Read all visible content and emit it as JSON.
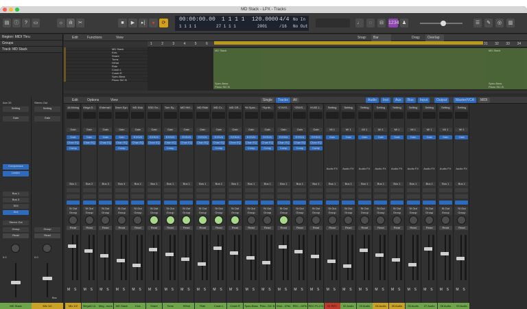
{
  "window": {
    "title": "MD Stack - LPX - Tracks"
  },
  "toolbar": {
    "lcd_time": "00:00:00.00",
    "lcd_bars": "1 1 1 1",
    "lcd_bars2": "1 1 1 1",
    "lcd_pos": "27 1 1 1",
    "tempo": "120.0000",
    "tempo_sub": "2001",
    "signature": "4/4",
    "division": "/16",
    "in_label": "No In",
    "out_label": "No Out",
    "badge": "1234"
  },
  "inspector": {
    "region": "Region: MIDI Thru",
    "groups": "Groups",
    "track": "Track: MD Stack"
  },
  "tracks_bar": {
    "edit": "Edit",
    "functions": "Functions",
    "view": "View",
    "snap_label": "Snap:",
    "snap_value": "Bar",
    "drag_label": "Drag:",
    "drag_value": "Overlap"
  },
  "ruler": [
    "1",
    "2",
    "3",
    "4",
    "5",
    "6",
    "7",
    "8",
    "9",
    "10",
    "11",
    "12",
    "13",
    "14",
    "15",
    "16",
    "17",
    "18",
    "19",
    "20",
    "21",
    "22",
    "23",
    "24",
    "25",
    "26",
    "27",
    "28",
    "29",
    "30",
    "31",
    "32",
    "33",
    "34"
  ],
  "track_rows": [
    "MD Stack",
    "Kick",
    "Snare",
    "Toms",
    "HiHat",
    "Ride",
    "Crash L",
    "Crash R",
    "Spec-Bass",
    "Piano SIC B"
  ],
  "regions": {
    "main": "MD Stack",
    "end": "MD Stack",
    "spec": "Spec-Bass",
    "piano": "Piano SIC B",
    "spec2": "Spec-Bass",
    "piano2": "Piano SIC B"
  },
  "mixer_bar": {
    "edit": "Edit",
    "options": "Options",
    "view": "View",
    "tabs_left": [
      "Single",
      "Tracks",
      "All"
    ],
    "tabs_right": [
      "Audio",
      "Inst",
      "Aux",
      "Bus",
      "Input",
      "Output",
      "Master/VCA",
      "MIDI"
    ]
  },
  "inspector_strips": {
    "left_name": "MD Stack",
    "left_eq": "Aux 33",
    "right_name": "Mix 1/2",
    "right_eq": "Stereo Out",
    "settings": "Setting",
    "left_group": "Group",
    "right_group": "Group",
    "read": "Read",
    "read2": "Read",
    "val_left": "0.0",
    "val_right": "0.0",
    "comp": "Compressor",
    "limiter": "Limiter",
    "gain": "Gain",
    "bus1": "Bus 1",
    "bus3": "Bus 3",
    "s503": "S03",
    "s504": "S04",
    "out": "Stereo Out",
    "bnc": "Bnc"
  },
  "channels": [
    {
      "name": "Mix 1/2",
      "plugin": "JA Mixing",
      "color": "#c9a227",
      "send": "Bus 1"
    },
    {
      "name": "MegaD Lit",
      "plugin": "Mega D...",
      "color": "#6fa54a",
      "send": "Bus 2"
    },
    {
      "name": "Meg...nuns",
      "plugin": "External I",
      "color": "#6fa54a",
      "send": "Bus 3"
    },
    {
      "name": "MD Stack",
      "plugin": "Drum Syn...",
      "color": "#6fa54a",
      "send": "Bus 4"
    },
    {
      "name": "Kick",
      "plugin": "MD Kick",
      "color": "#6fa54a",
      "send": "Bus 1"
    },
    {
      "name": "Snare",
      "plugin": "SSD Sn...",
      "color": "#6fa54a",
      "send": "Bus 1"
    },
    {
      "name": "Toms",
      "plugin": "Tom Sy...",
      "color": "#6fa54a",
      "send": "Bus 1"
    },
    {
      "name": "HiHat",
      "plugin": "MD HiH...",
      "color": "#6fa54a",
      "send": "Bus 1"
    },
    {
      "name": "Ride",
      "plugin": "MD Ride",
      "color": "#6fa54a",
      "send": "Bus 1"
    },
    {
      "name": "Crash L",
      "plugin": "MD Cr...",
      "color": "#6fa54a",
      "send": "Bus 1"
    },
    {
      "name": "Crash R",
      "plugin": "MD CR...",
      "color": "#6fa54a",
      "send": "Bus 1"
    },
    {
      "name": "Spec-Bass",
      "plugin": "*M Spec...",
      "color": "#6fa54a",
      "send": "Bus 1"
    },
    {
      "name": "Pian...SIC B",
      "plugin": "*Synth...",
      "color": "#6fa54a",
      "send": "Bus 1"
    },
    {
      "name": "Wurl...37bb",
      "plugin": "*Z BXS...",
      "color": "#6fa54a",
      "send": "Bus 1"
    },
    {
      "name": "REC...DiPA",
      "plugin": "*ZBXS...",
      "color": "#6fa54a",
      "send": "Bus 1"
    },
    {
      "name": "REC PL1+D",
      "plugin": "KV83 J...",
      "color": "#6fa54a",
      "send": "Bus 1"
    },
    {
      "name": "01 REC",
      "plugin": "Setting",
      "color": "#c0392b",
      "send": "Bus 1"
    },
    {
      "name": "02 Audio",
      "plugin": "Setting",
      "color": "#6fa54a",
      "send": "Bus 1"
    },
    {
      "name": "03 Audio",
      "plugin": "Setting",
      "color": "#6fa54a",
      "send": "Bus 1"
    },
    {
      "name": "04 Audio",
      "plugin": "Setting",
      "color": "#c9a227",
      "send": "Bus 1"
    },
    {
      "name": "05 Audio",
      "plugin": "Setting",
      "color": "#c9a227",
      "send": "Bus 1"
    },
    {
      "name": "06 Audio",
      "plugin": "Setting",
      "color": "#6fa54a",
      "send": "Bus 1"
    },
    {
      "name": "07 Audio",
      "plugin": "Setting",
      "color": "#6fa54a",
      "send": "Bus 1"
    },
    {
      "name": "08 Audio",
      "plugin": "Setting",
      "color": "#6fa54a",
      "send": "Bus 1"
    },
    {
      "name": "09 Audio",
      "plugin": "Setting",
      "color": "#6fa54a",
      "send": "Bus 1"
    }
  ],
  "strip_labels": {
    "gain": "Gain",
    "chan_eq": "Chan EQ",
    "comp": "Comp",
    "exs": "EXS24",
    "stout": "St Out",
    "group": "Group",
    "read": "Read",
    "m": "M",
    "s": "S",
    "audio_fx": "Audio FX",
    "input": "MI 1"
  }
}
